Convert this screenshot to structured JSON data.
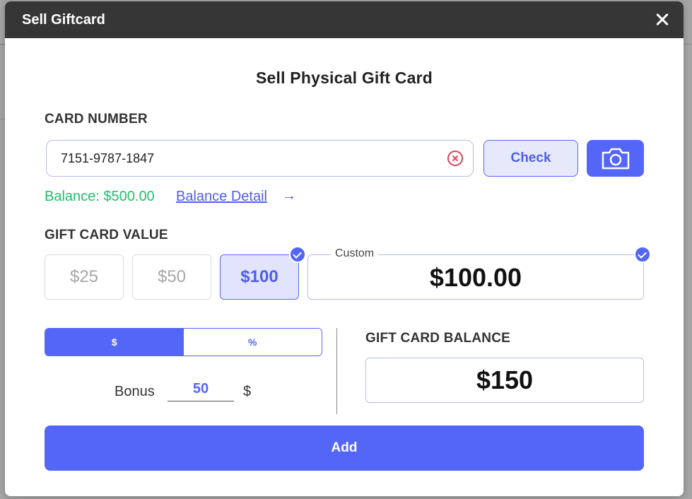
{
  "modal": {
    "title": "Sell Giftcard",
    "heading": "Sell Physical Gift Card"
  },
  "card_number": {
    "label": "CARD NUMBER",
    "value": "7151-9787-1847",
    "check_label": "Check",
    "balance_text": "Balance: $500.00",
    "balance_detail_label": "Balance Detail",
    "arrow": "→"
  },
  "gift_card_value": {
    "label": "GIFT CARD VALUE",
    "options": [
      {
        "label": "$25",
        "selected": false
      },
      {
        "label": "$50",
        "selected": false
      },
      {
        "label": "$100",
        "selected": true
      }
    ],
    "custom_legend": "Custom",
    "custom_value": "$100.00"
  },
  "bonus": {
    "toggle": [
      {
        "label": "$",
        "active": true
      },
      {
        "label": "%",
        "active": false
      }
    ],
    "label": "Bonus",
    "value": "50",
    "unit": "$"
  },
  "gift_card_balance": {
    "label": "GIFT CARD BALANCE",
    "value": "$150"
  },
  "add_label": "Add",
  "colors": {
    "accent": "#5366f7",
    "header": "#363636",
    "success": "#1fbf6c",
    "danger": "#e0405a"
  }
}
